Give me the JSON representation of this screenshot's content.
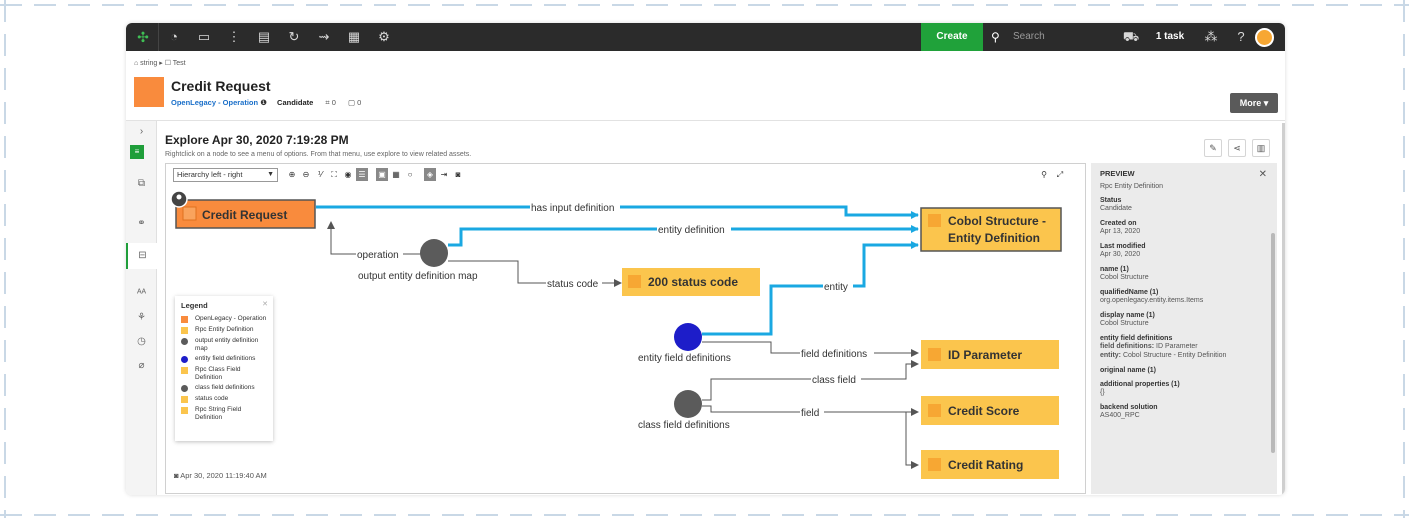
{
  "topbar": {
    "create_label": "Create",
    "search_placeholder": "Search",
    "task_label": "1 task"
  },
  "breadcrumb": "⌂ string ▸ ☐ Test",
  "asset": {
    "title": "Credit Request",
    "type_link": "OpenLegacy - Operation",
    "status": "Candidate",
    "tag_count": "0",
    "comment_count": "0",
    "more_label": "More ▾"
  },
  "explore": {
    "title": "Explore Apr 30, 2020 7:19:28 PM",
    "hint": "Rightclick on a node to see a menu of options. From that menu, use explore to view related assets.",
    "layout_select": "Hierarchy left - right",
    "snapshot_date": "Apr 30, 2020 11:19:40 AM"
  },
  "graph": {
    "nodes": {
      "credit_request": "Credit Request",
      "cobol_structure_l1": "Cobol Structure -",
      "cobol_structure_l2": "Entity Definition",
      "status_200": "200 status code",
      "id_parameter": "ID Parameter",
      "credit_score": "Credit Score",
      "credit_rating": "Credit Rating",
      "output_map": "output entity definition map",
      "entity_field_defs": "entity field definitions",
      "class_field_defs": "class field definitions"
    },
    "edges": {
      "has_input_definition": "has input definition",
      "entity_definition": "entity definition",
      "operation": "operation",
      "status_code": "status code",
      "entity": "entity",
      "field_definitions": "field definitions",
      "class_field": "class field",
      "field": "field"
    },
    "colors": {
      "orange": "#f98b3d",
      "yellow": "#fbc54d",
      "gray": "#5b5b5b",
      "blue": "#1d1dc9",
      "edge_blue": "#1aa8e2",
      "edge_gray": "#555555"
    }
  },
  "legend": {
    "title": "Legend",
    "items": [
      {
        "label": "OpenLegacy - Operation",
        "color": "#f98b3d",
        "shape": "square"
      },
      {
        "label": "Rpc Entity Definition",
        "color": "#fbc54d",
        "shape": "square"
      },
      {
        "label": "output entity definition map",
        "color": "#5b5b5b",
        "shape": "circle"
      },
      {
        "label": "entity field definitions",
        "color": "#1d1dc9",
        "shape": "circle"
      },
      {
        "label": "Rpc Class Field Definition",
        "color": "#fbc54d",
        "shape": "square"
      },
      {
        "label": "class field definitions",
        "color": "#5b5b5b",
        "shape": "circle"
      },
      {
        "label": "status code",
        "color": "#fbc54d",
        "shape": "square"
      },
      {
        "label": "Rpc String Field Definition",
        "color": "#fbc54d",
        "shape": "square"
      }
    ]
  },
  "preview": {
    "header": "PREVIEW",
    "subtitle": "Rpc Entity Definition",
    "fields": [
      {
        "k": "Status",
        "v": "Candidate"
      },
      {
        "k": "Created on",
        "v": "Apr 13, 2020"
      },
      {
        "k": "Last modified",
        "v": "Apr 30, 2020"
      },
      {
        "k": "name (1)",
        "v": "Cobol Structure"
      },
      {
        "k": "qualifiedName (1)",
        "v": "org.openlegacy.entity.items.Items"
      },
      {
        "k": "display name (1)",
        "v": "Cobol Structure"
      }
    ],
    "efd_title": "entity field definitions",
    "efd_field_key": "field definitions:",
    "efd_field_val": "ID Parameter",
    "efd_entity_key": "entity:",
    "efd_entity_val": "Cobol Structure - Entity Definition",
    "original_name": "original name (1)",
    "additional_key": "additional properties (1)",
    "additional_val": "{}",
    "backend_key": "backend solution",
    "backend_val": "AS400_RPC"
  }
}
